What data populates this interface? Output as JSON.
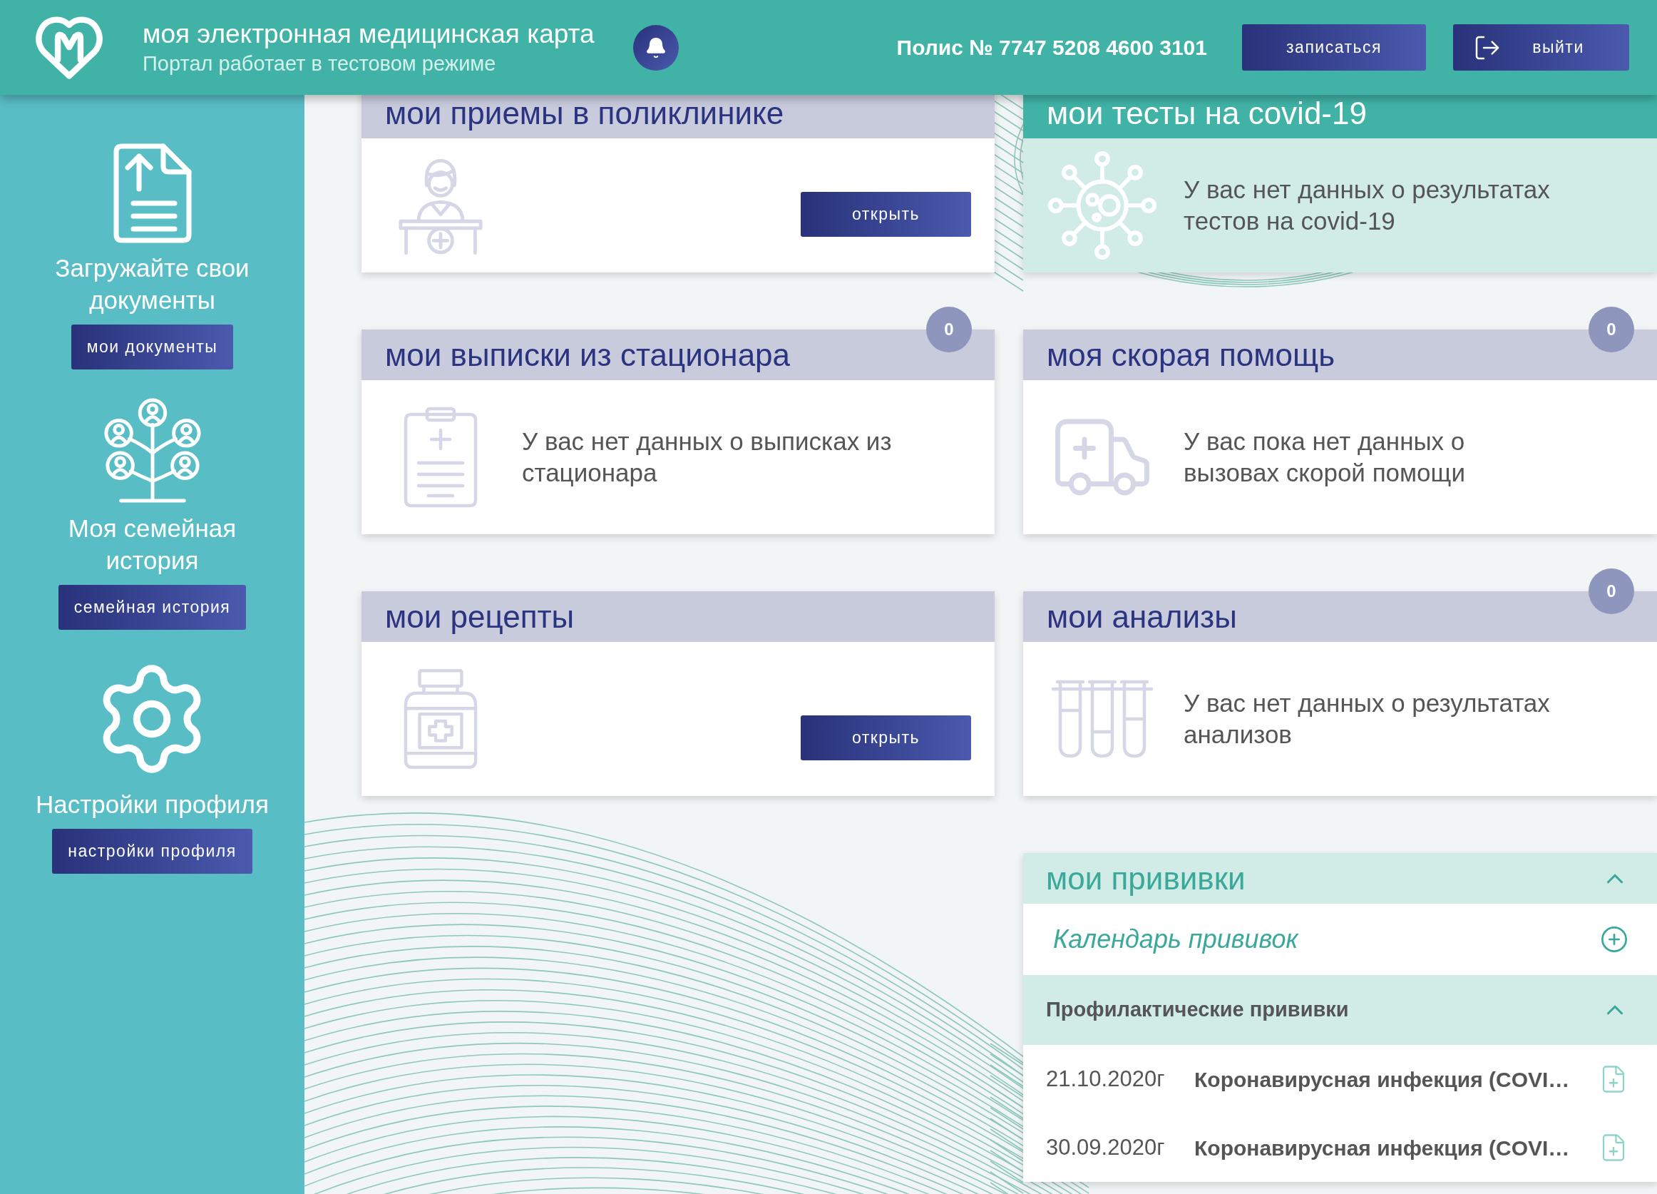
{
  "header": {
    "title": "моя электронная медицинская карта",
    "subtitle": "Портал работает в тестовом режиме",
    "policy": "Полис № 7747 5208 4600 3101",
    "buttons": [
      {
        "kind": "signup",
        "label": "записаться"
      },
      {
        "kind": "logout",
        "label": "выйти"
      }
    ]
  },
  "sidebar": {
    "items": [
      {
        "kind": "documents",
        "title_lines": [
          "Загружайте свои",
          "документы"
        ],
        "button": "мои документы"
      },
      {
        "kind": "family",
        "title_lines": [
          "Моя семейная",
          "история"
        ],
        "button": "семейная история"
      },
      {
        "kind": "settings",
        "title_lines": [
          "Настройки профиля"
        ],
        "button": "настройки профиля"
      }
    ]
  },
  "card_rows": [
    {
      "cards": [
        {
          "kind": "appointments",
          "title": "мои приемы в поликлинике",
          "button": "открыть"
        },
        {
          "kind": "covid",
          "title": "мои тесты на covid-19",
          "message_lines": [
            "У вас нет данных о результатах",
            "тестов на covid-19"
          ]
        }
      ]
    },
    {
      "cards": [
        {
          "kind": "discharges",
          "title": "мои выписки из стационара",
          "badge": "0",
          "message_lines": [
            "У вас нет данных о выписках из",
            "стационара"
          ]
        },
        {
          "kind": "ambulance",
          "title": "моя скорая помощь",
          "badge": "0",
          "message_lines": [
            "У вас пока нет данных о",
            "вызовах скорой помощи"
          ]
        }
      ]
    },
    {
      "cards": [
        {
          "kind": "prescriptions",
          "title": "мои рецепты",
          "button": "открыть"
        },
        {
          "kind": "analyses",
          "title": "мои анализы",
          "badge": "0",
          "message_lines": [
            "У вас нет данных о результатах",
            "анализов"
          ]
        }
      ]
    }
  ],
  "vaccinations": {
    "title": "мои прививки",
    "expanded": true,
    "calendar_link": "Календарь прививок",
    "groups": [
      {
        "title": "Профилактические прививки",
        "expanded": true,
        "rows": [
          {
            "date": "21.10.2020г",
            "name": "Коронавирусная инфекция (COVI…"
          },
          {
            "date": "30.09.2020г",
            "name": "Коронавирусная инфекция (COVI…"
          }
        ]
      }
    ]
  }
}
